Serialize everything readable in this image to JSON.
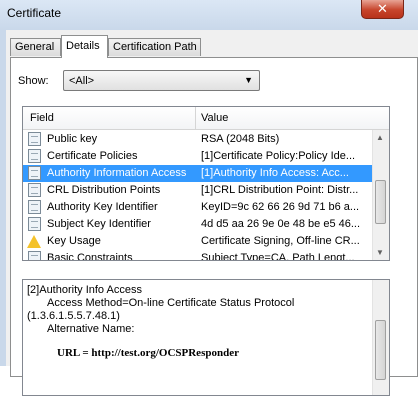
{
  "window": {
    "title": "Certificate",
    "close_label": "✕"
  },
  "tabs": [
    {
      "label": "General",
      "active": false
    },
    {
      "label": "Details",
      "active": true
    },
    {
      "label": "Certification Path",
      "active": false
    }
  ],
  "show": {
    "label": "Show:",
    "value": "<All>",
    "arrow": "▼"
  },
  "fields_table": {
    "headers": {
      "field": "Field",
      "value": "Value"
    },
    "rows": [
      {
        "field": "Public key",
        "value": "RSA (2048 Bits)",
        "icon": "certificate-field-icon"
      },
      {
        "field": "Certificate Policies",
        "value": "[1]Certificate Policy:Policy Ide...",
        "icon": "certificate-extension-icon"
      },
      {
        "field": "Authority Information Access",
        "value": "[1]Authority Info Access: Acc...",
        "icon": "certificate-extension-icon",
        "selected": true
      },
      {
        "field": "CRL Distribution Points",
        "value": "[1]CRL Distribution Point: Distr...",
        "icon": "certificate-extension-icon"
      },
      {
        "field": "Authority Key Identifier",
        "value": "KeyID=9c 62 66 26 9d 71 b6 a...",
        "icon": "certificate-extension-icon"
      },
      {
        "field": "Subject Key Identifier",
        "value": "4d d5 aa 26 9e 0e 48 be e5 46...",
        "icon": "certificate-extension-icon"
      },
      {
        "field": "Key Usage",
        "value": "Certificate Signing, Off-line CR...",
        "icon": "warning-icon"
      },
      {
        "field": "Basic Constraints",
        "value": "Subject Type=CA, Path Lengt...",
        "icon": "certificate-extension-icon"
      }
    ]
  },
  "detail": {
    "lines": [
      "[2]Authority Info Access",
      "Access Method=On-line Certificate Status Protocol",
      "(1.3.6.1.5.5.7.48.1)",
      "Alternative Name:"
    ],
    "url_line": "URL = http://test.org/OCSPResponder"
  },
  "scroll": {
    "up": "▲",
    "down": "▼"
  },
  "colors": {
    "selection": "#3399ff",
    "frame": "#c9d8ea",
    "close_button": "#c7452c"
  }
}
